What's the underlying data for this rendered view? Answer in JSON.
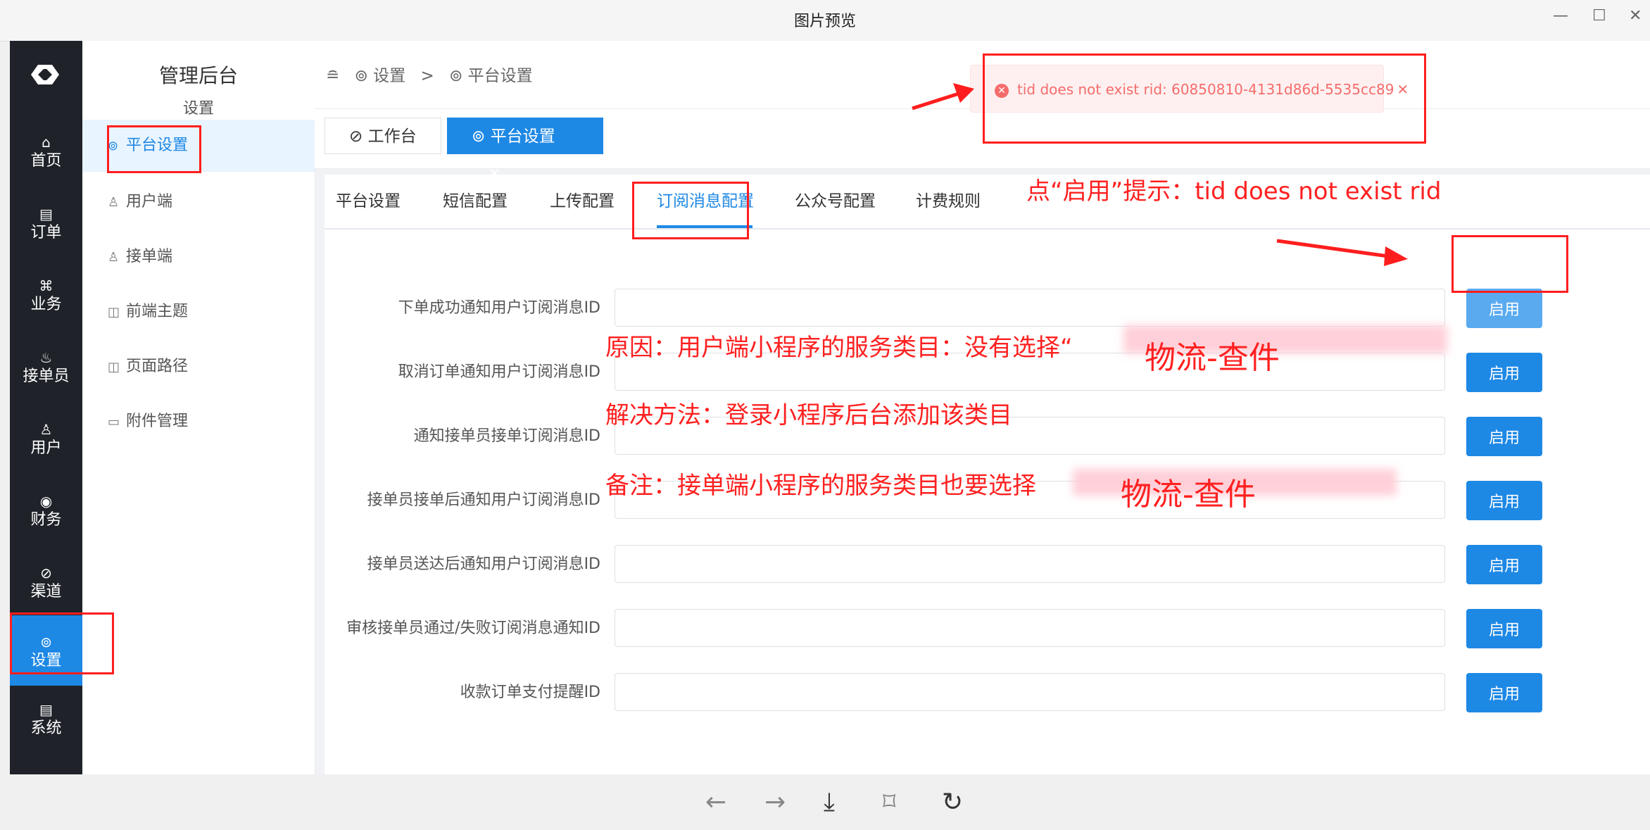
{
  "window": {
    "title": "图片预览",
    "minimize": "—",
    "maximize": "☐",
    "close": "✕"
  },
  "app": {
    "nav": [
      {
        "label": "首页",
        "icon": "⌂"
      },
      {
        "label": "订单",
        "icon": "▤"
      },
      {
        "label": "业务",
        "icon": "⌘"
      },
      {
        "label": "接单员",
        "icon": "♨"
      },
      {
        "label": "用户",
        "icon": "♙"
      },
      {
        "label": "财务",
        "icon": "◉"
      },
      {
        "label": "渠道",
        "icon": "⊘"
      },
      {
        "label": "设置",
        "icon": "⊚"
      },
      {
        "label": "系统",
        "icon": "▤"
      }
    ],
    "sub": {
      "title": "管理后台",
      "group": "设置",
      "items": [
        {
          "label": "平台设置",
          "icon": "⊚"
        },
        {
          "label": "用户端",
          "icon": "♙"
        },
        {
          "label": "接单端",
          "icon": "♙"
        },
        {
          "label": "前端主题",
          "icon": "◫"
        },
        {
          "label": "页面路径",
          "icon": "◫"
        },
        {
          "label": "附件管理",
          "icon": "▭"
        }
      ]
    },
    "breadcrumb": {
      "toggle": "≘",
      "root": "⊚ 设置",
      "sep": ">",
      "current": "⊚ 平台设置"
    },
    "tags": [
      {
        "label": "⊘ 工作台"
      },
      {
        "label": "⊚ 平台设置",
        "close": "✕"
      }
    ],
    "tabs": [
      "平台设置",
      "短信配置",
      "上传配置",
      "订阅消息配置",
      "公众号配置",
      "计费规则"
    ],
    "rows": [
      {
        "label": "下单成功通知用户订阅消息ID",
        "value": "",
        "btn": "启用"
      },
      {
        "label": "取消订单通知用户订阅消息ID",
        "value": "",
        "btn": "启用"
      },
      {
        "label": "通知接单员接单订阅消息ID",
        "value": "",
        "btn": "启用"
      },
      {
        "label": "接单员接单后通知用户订阅消息ID",
        "value": "",
        "btn": "启用"
      },
      {
        "label": "接单员送达后通知用户订阅消息ID",
        "value": "",
        "btn": "启用"
      },
      {
        "label": "审核接单员通过/失败订阅消息通知ID",
        "value": "",
        "btn": "启用"
      },
      {
        "label": "收款订单支付提醒ID",
        "value": "",
        "btn": "启用"
      }
    ],
    "toast": {
      "icon": "✕",
      "text": "tid does not exist rid: 60850810-4131d86d-5535cc89",
      "close": "✕"
    }
  },
  "annotations": {
    "hint": "点“启用”提示：tid does not exist rid",
    "reason": "原因：用户端小程序的服务类目：没有选择“",
    "reason_item": "物流-查件",
    "solution": "解决方法：登录小程序后台添加该类目",
    "note": "备注：接单端小程序的服务类目也要选择",
    "note_item": "物流-查件",
    "color": "#ff2020"
  },
  "toolbar": {
    "prev": "←",
    "next": "→",
    "download": "⤓",
    "fit": "⌑",
    "rotate": "↻"
  }
}
